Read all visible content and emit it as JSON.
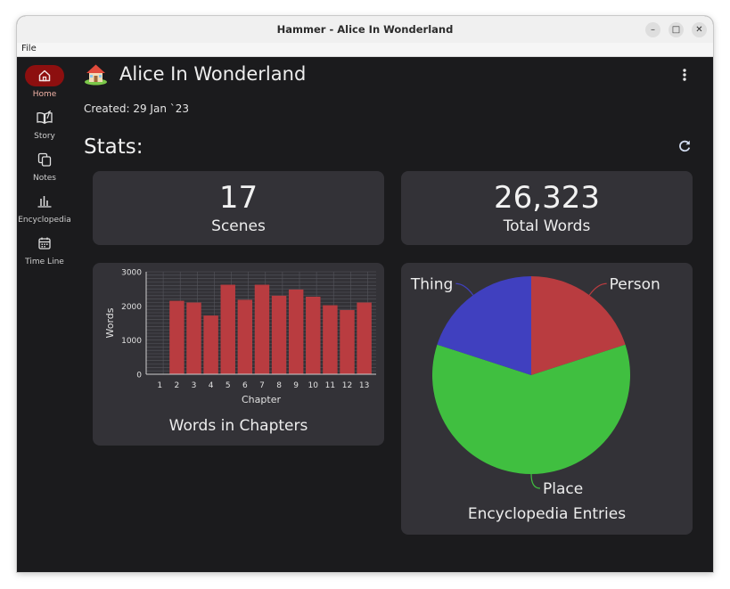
{
  "window": {
    "title": "Hammer - Alice In Wonderland",
    "minimize_label": "–",
    "maximize_label": "□",
    "close_label": "✕"
  },
  "menu": {
    "file": "File"
  },
  "nav": {
    "items": [
      {
        "label": "Home",
        "icon": "home-icon",
        "active": true
      },
      {
        "label": "Story",
        "icon": "book-icon",
        "active": false
      },
      {
        "label": "Notes",
        "icon": "notes-icon",
        "active": false
      },
      {
        "label": "Encyclopedia",
        "icon": "bar-chart-icon",
        "active": false
      },
      {
        "label": "Time Line",
        "icon": "calendar-icon",
        "active": false
      }
    ]
  },
  "project": {
    "title": "Alice In Wonderland",
    "created": "Created: 29 Jan `23"
  },
  "stats": {
    "heading": "Stats:",
    "scenes": {
      "value": "17",
      "label": "Scenes"
    },
    "words": {
      "value": "26,323",
      "label": "Total Words"
    }
  },
  "chart_data": [
    {
      "type": "bar",
      "title": "Words in Chapters",
      "xlabel": "Chapter",
      "ylabel": "Words",
      "categories": [
        "1",
        "2",
        "3",
        "4",
        "5",
        "6",
        "7",
        "8",
        "9",
        "10",
        "11",
        "12",
        "13"
      ],
      "values": [
        0,
        2150,
        2100,
        1720,
        2620,
        2180,
        2620,
        2300,
        2480,
        2270,
        2020,
        1880,
        2100
      ],
      "ylim": [
        0,
        3000
      ],
      "yticks": [
        "0",
        "1000",
        "2000",
        "3000"
      ],
      "grid": true,
      "bar_color": "#b93c40"
    },
    {
      "type": "pie",
      "title": "Encyclopedia Entries",
      "categories": [
        "Person",
        "Place",
        "Thing"
      ],
      "values": [
        20,
        60,
        20
      ],
      "colors": [
        "#b93c40",
        "#40bf40",
        "#4040bf"
      ]
    }
  ],
  "colors": {
    "accent": "#8d0f0f",
    "card": "#333237",
    "background": "#1b1b1d"
  }
}
